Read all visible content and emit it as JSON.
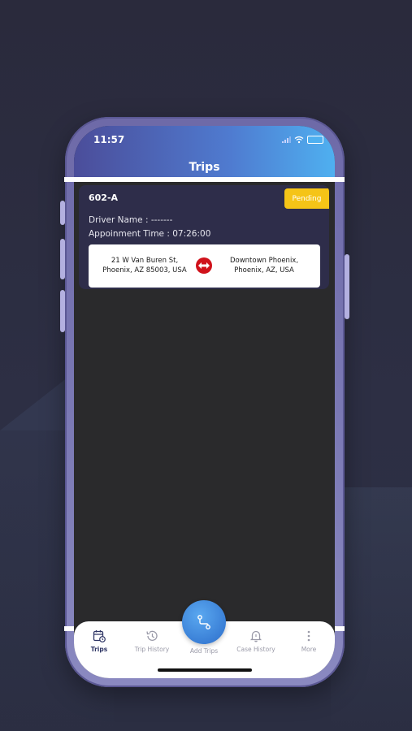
{
  "status_bar": {
    "time": "11:57"
  },
  "header": {
    "title": "Trips"
  },
  "trip": {
    "id": "602-A",
    "status": "Pending",
    "driver_line": "Driver Name : -------",
    "appointment_line": "Appoinment Time : 07:26:00",
    "from_line1": "21 W Van Buren St,",
    "from_line2": "Phoenix, AZ 85003, USA",
    "to_line1": "Downtown Phoenix,",
    "to_line2": "Phoenix, AZ, USA"
  },
  "tabs": [
    {
      "label": "Trips",
      "icon": "calendar-clock-icon",
      "active": true
    },
    {
      "label": "Trip History",
      "icon": "history-icon",
      "active": false
    },
    {
      "label": "Add Trips",
      "icon": "route-icon",
      "active": false
    },
    {
      "label": "Case History",
      "icon": "bell-icon",
      "active": false
    },
    {
      "label": "More",
      "icon": "more-vertical-icon",
      "active": false
    }
  ],
  "colors": {
    "header_start": "#4b4d9a",
    "header_end": "#4fb0f0",
    "pending": "#f5c417",
    "card_bg": "#2e2d4a",
    "swap_icon": "#d0121b",
    "fab": "#3a7fd6"
  }
}
